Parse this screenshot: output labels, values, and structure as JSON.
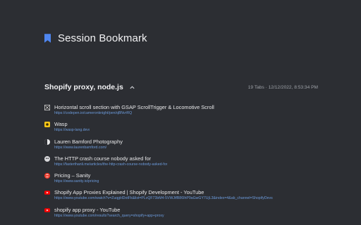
{
  "app": {
    "title": "Session Bookmark",
    "icon": "bookmark-icon",
    "accent": "#4f86f0"
  },
  "group": {
    "title": "Shopify proxy, node.js",
    "meta": "19 Tabs · 12/12/2022, 8:53:34 PM",
    "toggle_icon": "chevron-up-icon"
  },
  "tabs": [
    {
      "title": "Horizontal scroll section with GSAP ScrollTrigger & Locomotive Scroll",
      "url": "https://codepen.io/cameronknight/pen/qBNvrRQ",
      "icon": "codepen-icon"
    },
    {
      "title": "Wasp",
      "url": "https://wasp-lang.dev/",
      "icon": "wasp-icon"
    },
    {
      "title": "Lauren Bamford Photography",
      "url": "https://www.laurenbamford.com/",
      "icon": "photo-icon"
    },
    {
      "title": "The HTTP crash course nobody asked for",
      "url": "https://fasterthanli.me/articles/the-http-crash-course-nobody-asked-for",
      "icon": "fasterthanlime-icon"
    },
    {
      "title": "Pricing – Sanity",
      "url": "https://www.sanity.io/pricing",
      "icon": "sanity-icon"
    },
    {
      "title": "Shopify App Proxies Explained | Shopify Development - YouTube",
      "url": "https://www.youtube.com/watch?v=ZuqgHDotFk&list=PLvQF73bM4-5VWJtfB86IhP9aGwGY7UjL3&index=4&ab_channel=ShopifyDevs",
      "icon": "youtube-icon"
    },
    {
      "title": "shopify app proxy - YouTube",
      "url": "https://www.youtube.com/results?search_query=shopify+app+proxy",
      "icon": "youtube-icon"
    }
  ]
}
